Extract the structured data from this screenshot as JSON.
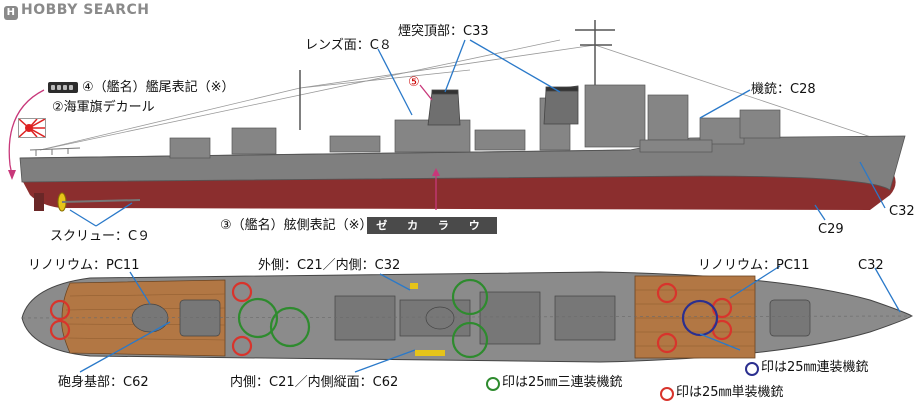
{
  "watermark": {
    "logo": "H",
    "text": "HOBBY SEARCH"
  },
  "labels": {
    "lens": "レンズ面：C８",
    "funnel_top": "煙突頂部：C33",
    "stern_name": "④（艦名）艦尾表記（※）",
    "ensign": "②海軍旗デカール",
    "gun": "機銃：C28",
    "num5": "⑤",
    "screw": "スクリュー：C９",
    "side_name": "③（艦名）舷側表記（※）",
    "decal_text": "ゼ カ ラ ウ",
    "c32_side": "C32",
    "c29": "C29",
    "linoleum_left": "リノリウム：PC11",
    "outer_inner": "外側：C21／内側：C32",
    "linoleum_right": "リノリウム：PC11",
    "c32_deck": "C32",
    "barrel_base": "砲身基部：C62",
    "inner_vertical": "内側：C21／内側縦面：C62",
    "legend_triple": "印は25㎜三連装機銃",
    "legend_twin": "印は25㎜連装機銃",
    "legend_single": "印は25㎜単装機銃"
  },
  "colors": {
    "hull_grey": "#7f7f7f",
    "hull_red": "#8b2e2e",
    "linoleum": "#b27744",
    "single_mg": "#d8342c",
    "triple_mg": "#2e8b2e",
    "twin_mg": "#2b2f8f",
    "leader_blue": "#2a79c9",
    "leader_pink": "#c8387a"
  }
}
